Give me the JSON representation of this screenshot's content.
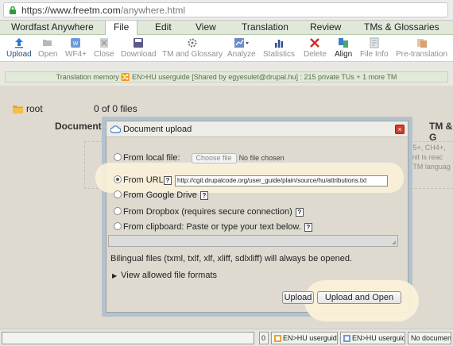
{
  "browser": {
    "url_host": "https://www.freetm.com",
    "url_path": "/anywhere.html"
  },
  "menu": {
    "items": [
      "Wordfast Anywhere",
      "File",
      "Edit",
      "View",
      "Translation",
      "Review",
      "TMs & Glossaries"
    ],
    "active": "File"
  },
  "toolbar": {
    "items": [
      "Upload",
      "Open",
      "WF4+",
      "Close",
      "Download",
      "TM and Glossary",
      "Analyze",
      "Statistics",
      "Delete",
      "Align",
      "File Info",
      "Pre-translation"
    ]
  },
  "infobar": {
    "text": "Translation memory 🔀 EN>HU userguide [Shared by egyesulet@drupal.hu] : 215 private TUs + 1 more TM"
  },
  "files": {
    "root_label": "root",
    "count_text": "0 of 0 files",
    "col_document": "Document",
    "col_tm": "TM & G",
    "side_note": [
      "3.5+, CH4+,",
      "limit is reac",
      "e TM languag"
    ]
  },
  "dialog": {
    "title": "Document upload",
    "close": "×",
    "options": {
      "local": "From local file:",
      "choose_file": "Choose file",
      "no_file": "No file chosen",
      "url": "From URL:",
      "url_value": "http://cgit.drupalcode.org/user_guide/plain/source/hu/attributions.txt",
      "gdrive": "From Google Drive",
      "dropbox": "From Dropbox (requires secure connection)",
      "clipboard": "From clipboard: Paste or type your text below."
    },
    "help_glyph": "?",
    "bilingual_note": "Bilingual files (txml, txlf, xlf, xliff, sdlxliff) will always be opened.",
    "allowed_formats": "View allowed file formats",
    "upload_label": "Upload",
    "upload_open_label": "Upload and Open"
  },
  "statusbar": {
    "zero": "0",
    "tm1": "EN>HU userguide",
    "tm2": "EN>HU userguide",
    "no_document": "No document"
  },
  "colors": {
    "menu_bg": "#dfe8d9",
    "dialog_close": "#d33a2c",
    "highlight": "#fbf1d8"
  }
}
